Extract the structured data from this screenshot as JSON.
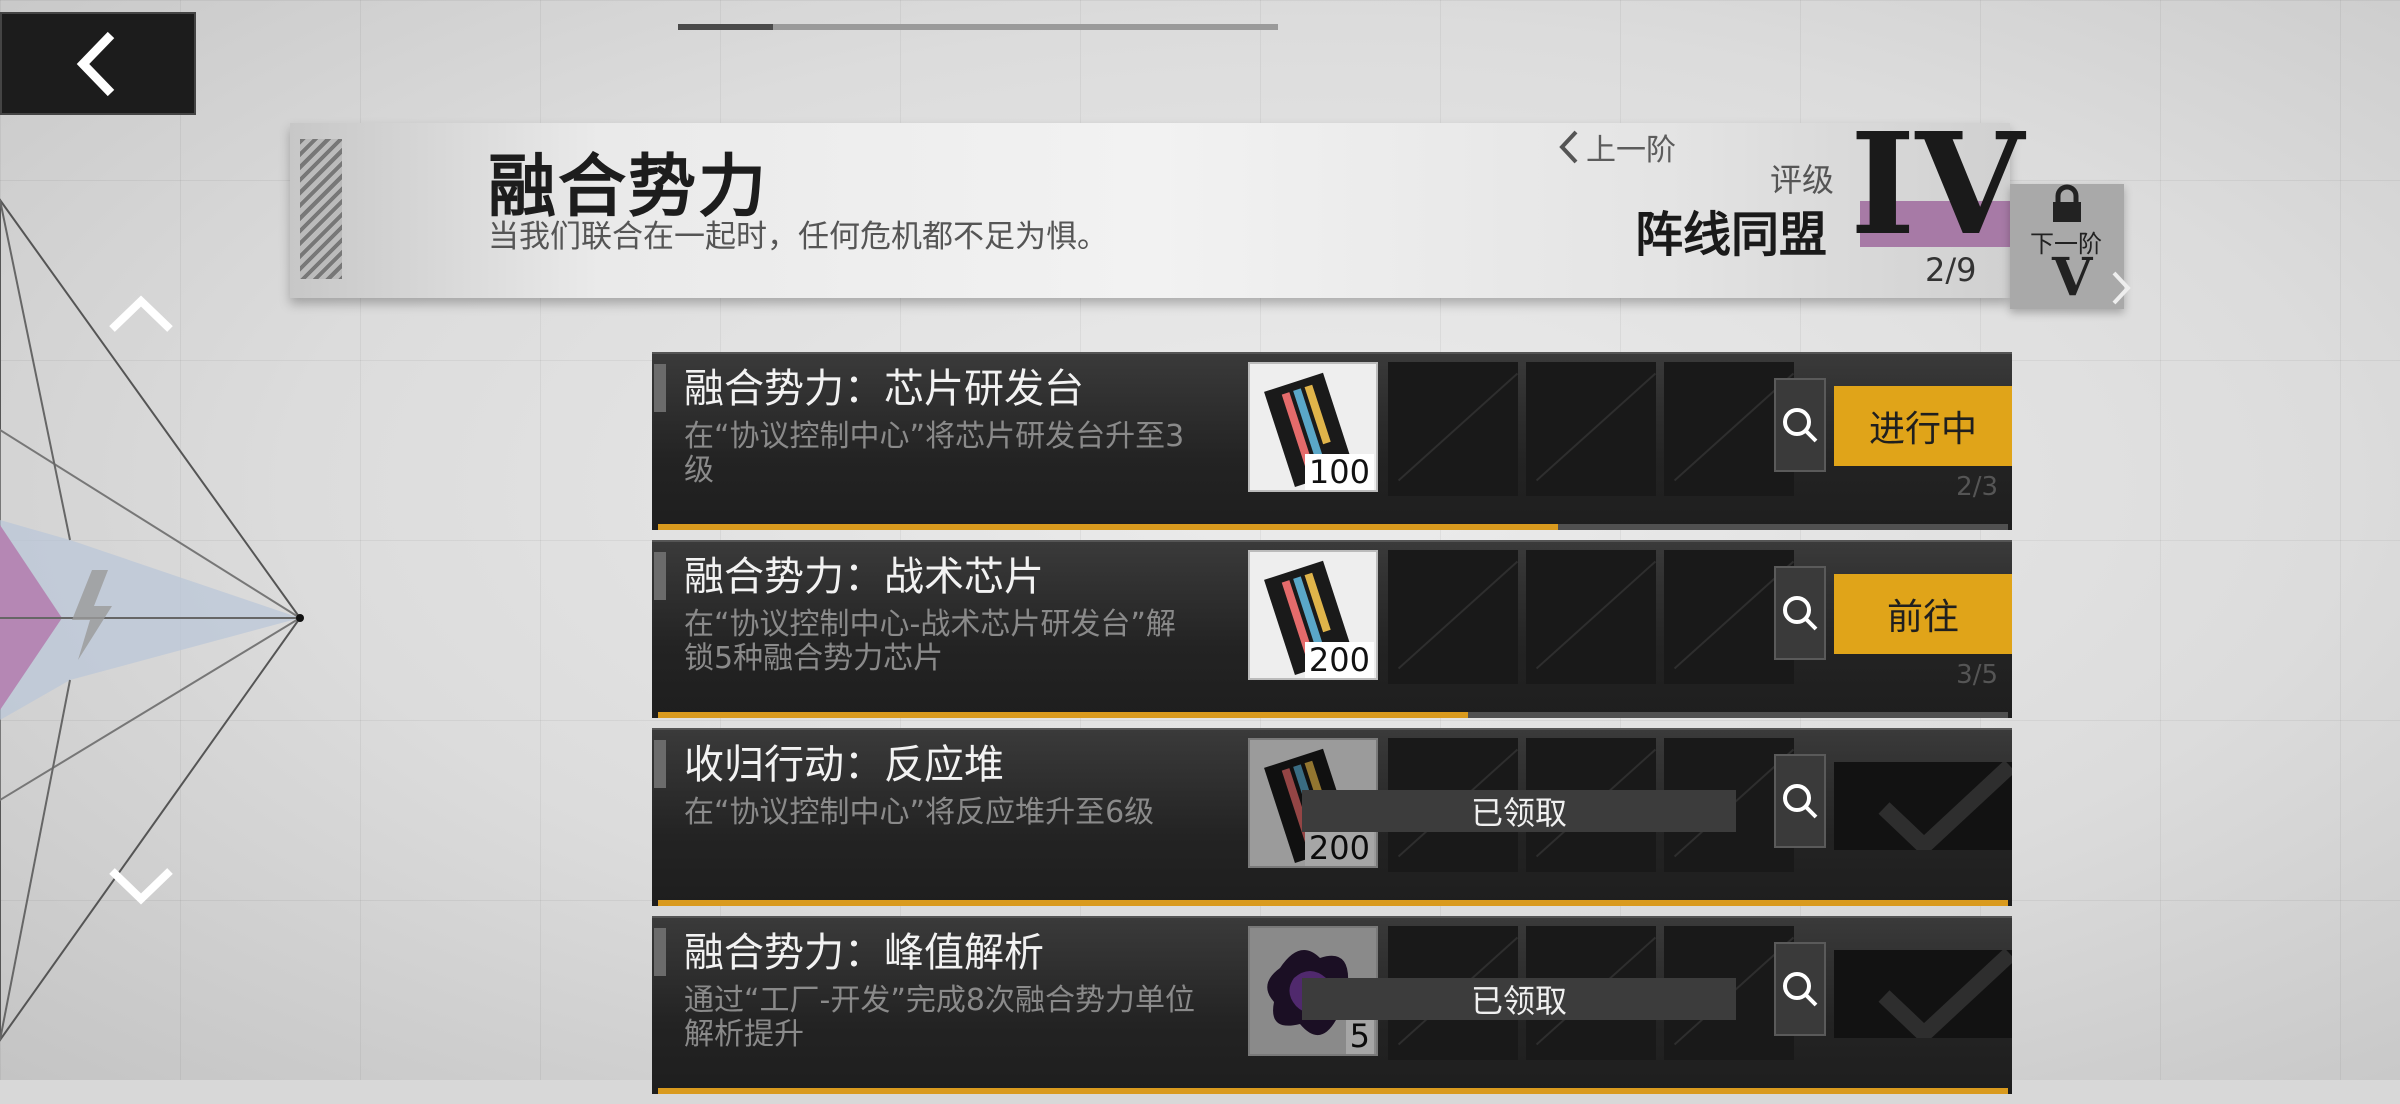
{
  "header": {
    "title": "融合势力",
    "subtitle": "当我们联合在一起时，任何危机都不足为惧。",
    "prev_tier": "上一阶",
    "grade_label": "评级",
    "grade_name": "阵线同盟",
    "grade_numeral": "IV",
    "grade_progress": "2/9",
    "next_tier_label": "下一阶",
    "next_tier_numeral": "V"
  },
  "colors": {
    "accent": "#e0a419",
    "grade_band": "#a77aa6",
    "panel": "#232323"
  },
  "missions": [
    {
      "title": "融合势力：芯片研发台",
      "desc": "在“协议控制中心”将芯片研发台升至3级",
      "reward_count": "100",
      "action": "进行中",
      "progress_text": "2/3",
      "progress": 0.667,
      "claimed": false
    },
    {
      "title": "融合势力：战术芯片",
      "desc": "在“协议控制中心-战术芯片研发台”解锁5种融合势力芯片",
      "reward_count": "200",
      "action": "前往",
      "progress_text": "3/5",
      "progress": 0.6,
      "claimed": false
    },
    {
      "title": "收归行动：反应堆",
      "desc": "在“协议控制中心”将反应堆升至6级",
      "reward_count": "200",
      "claimed_label": "已领取",
      "progress": 1.0,
      "claimed": true
    },
    {
      "title": "融合势力：峰值解析",
      "desc": "通过“工厂-开发”完成8次融合势力单位解析提升",
      "reward_count": "5",
      "claimed_label": "已领取",
      "progress": 1.0,
      "claimed": true
    }
  ]
}
